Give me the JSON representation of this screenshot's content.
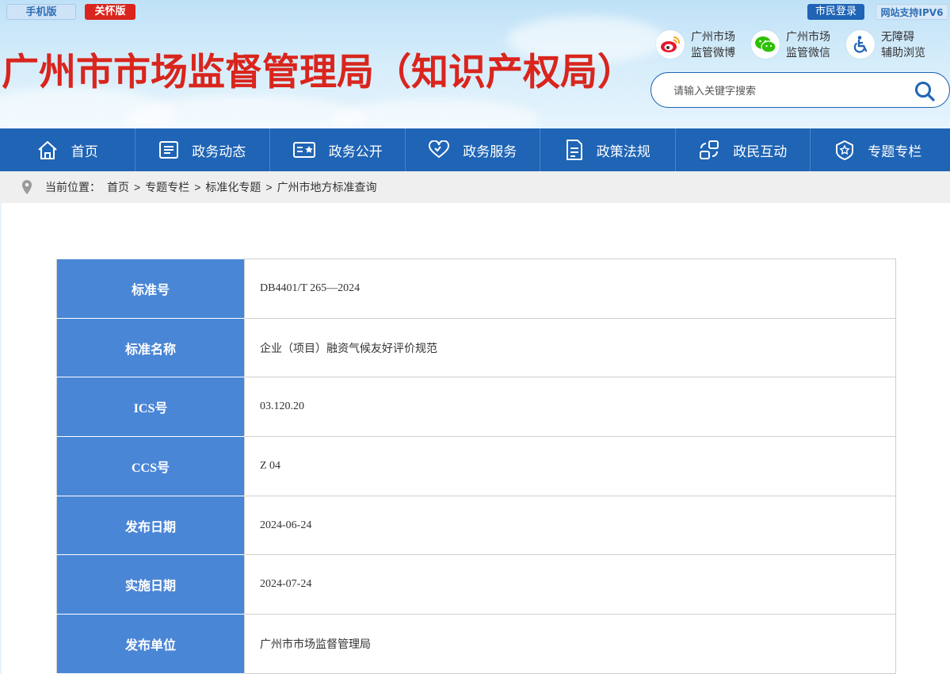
{
  "top_bar": {
    "mobile_version": "手机版",
    "care_version": "关怀版",
    "citizen_login": "市民登录",
    "ipv6": "网站支持IPV6"
  },
  "site_title": "广州市市场监督管理局（知识产权局）",
  "social": {
    "weibo": {
      "line1": "广州市场",
      "line2": "监管微博",
      "icon": "weibo-icon"
    },
    "wechat": {
      "line1": "广州市场",
      "line2": "监管微信",
      "icon": "wechat-icon"
    },
    "accessibility": {
      "line1": "无障碍",
      "line2": "辅助浏览",
      "icon": "wheelchair-icon"
    }
  },
  "search": {
    "placeholder": "请输入关键字搜索"
  },
  "nav": {
    "items": [
      {
        "label": "首页",
        "icon": "home-icon"
      },
      {
        "label": "政务动态",
        "icon": "news-icon"
      },
      {
        "label": "政务公开",
        "icon": "public-info-icon"
      },
      {
        "label": "政务服务",
        "icon": "heart-icon"
      },
      {
        "label": "政策法规",
        "icon": "document-icon"
      },
      {
        "label": "政民互动",
        "icon": "interaction-icon"
      },
      {
        "label": "专题专栏",
        "icon": "star-badge-icon"
      }
    ]
  },
  "breadcrumb": {
    "prefix": "当前位置：",
    "items": [
      "首页",
      "专题专栏",
      "标准化专题",
      "广州市地方标准查询"
    ],
    "separator": ">"
  },
  "standard": {
    "rows": [
      {
        "label": "标准号",
        "value": "DB4401/T 265—2024"
      },
      {
        "label": "标准名称",
        "value": "企业（项目）融资气候友好评价规范"
      },
      {
        "label": "ICS号",
        "value": "03.120.20"
      },
      {
        "label": "CCS号",
        "value": "Z 04"
      },
      {
        "label": "发布日期",
        "value": "2024-06-24"
      },
      {
        "label": "实施日期",
        "value": "2024-07-24"
      },
      {
        "label": "发布单位",
        "value": "广州市市场监督管理局"
      }
    ]
  },
  "colors": {
    "brand_red": "#d9251d",
    "nav_blue": "#1f64b5",
    "table_header_blue": "#4a86d6"
  }
}
